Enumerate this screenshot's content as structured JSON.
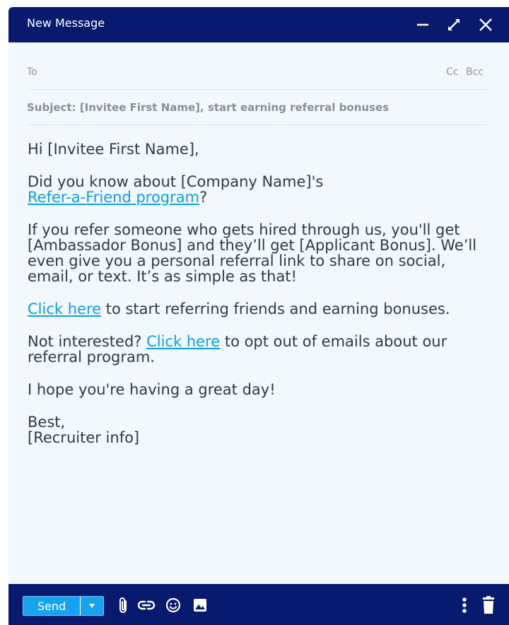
{
  "window": {
    "title": "New Message"
  },
  "header": {
    "to_label": "To",
    "cc_label": "Cc",
    "bcc_label": "Bcc",
    "subject": "Subject: [Invitee First Name], start earning referral bonuses"
  },
  "body": {
    "greeting": "Hi [Invitee First Name],",
    "p1_text": "Did you know about [Company Name]'s",
    "p1_link": "Refer-a-Friend program",
    "p1_end": "?",
    "p2": "If you refer someone who gets hired through us, you'll get [Ambassador Bonus] and they’ll get [Applicant Bonus]. We’ll even give you a personal referral link to share on social, email, or text. It’s as simple as that!",
    "p3_link": "Click here",
    "p3_text": " to start referring friends and earning bonuses.",
    "p4_text": "Not interested? ",
    "p4_link": "Click here",
    "p4_end": " to opt out of emails about our referral program.",
    "p5": "I hope you're having a great day!",
    "closing": "Best,",
    "signature": "[Recruiter info]"
  },
  "toolbar": {
    "send_label": "Send"
  },
  "icons": {
    "minimize": "minimize-icon",
    "expand": "expand-icon",
    "close": "close-icon",
    "caret": "caret-down-icon",
    "attach": "paperclip-icon",
    "link": "link-icon",
    "emoji": "emoji-icon",
    "image": "image-icon",
    "more": "more-vertical-icon",
    "delete": "trash-icon"
  },
  "colors": {
    "titlebar": "#071a6e",
    "background": "#f2f8fb",
    "link": "#0fa0e0",
    "send": "#18a3ef"
  }
}
